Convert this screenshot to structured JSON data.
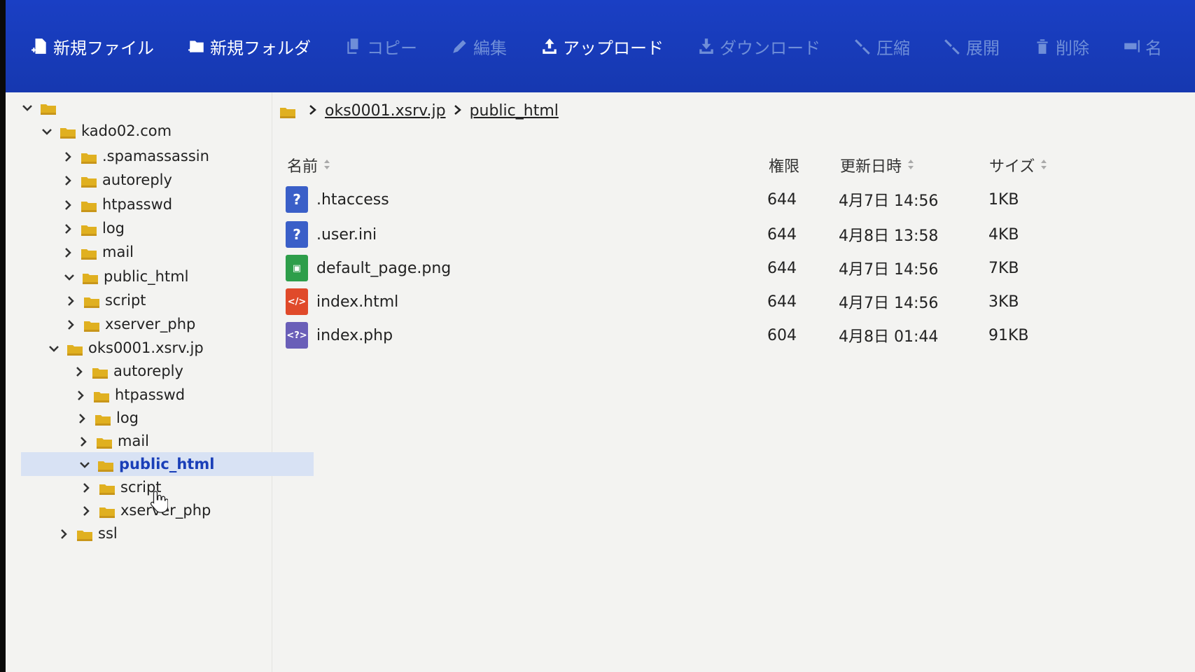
{
  "toolbar": {
    "buttons": [
      {
        "label": "新規ファイル",
        "icon": "new-file-icon",
        "enabled": true
      },
      {
        "label": "新規フォルダ",
        "icon": "new-folder-icon",
        "enabled": true
      },
      {
        "label": "コピー",
        "icon": "copy-icon",
        "enabled": false
      },
      {
        "label": "編集",
        "icon": "edit-icon",
        "enabled": false
      },
      {
        "label": "アップロード",
        "icon": "upload-icon",
        "enabled": true
      },
      {
        "label": "ダウンロード",
        "icon": "download-icon",
        "enabled": false
      },
      {
        "label": "圧縮",
        "icon": "compress-icon",
        "enabled": false
      },
      {
        "label": "展開",
        "icon": "extract-icon",
        "enabled": false
      },
      {
        "label": "削除",
        "icon": "trash-icon",
        "enabled": false
      },
      {
        "label": "名",
        "icon": "rename-icon",
        "enabled": false
      }
    ]
  },
  "tree": {
    "items": [
      {
        "label": "",
        "level": 0,
        "expanded": true
      },
      {
        "label": "kado02.com",
        "level": 1,
        "expanded": true
      },
      {
        "label": ".spamassassin",
        "level": 2,
        "expanded": false
      },
      {
        "label": "autoreply",
        "level": 2,
        "expanded": false
      },
      {
        "label": "htpasswd",
        "level": 2,
        "expanded": false
      },
      {
        "label": "log",
        "level": 2,
        "expanded": false
      },
      {
        "label": "mail",
        "level": 2,
        "expanded": false
      },
      {
        "label": "public_html",
        "level": 2,
        "expanded": true
      },
      {
        "label": "script",
        "level": 2,
        "expanded": false
      },
      {
        "label": "xserver_php",
        "level": 2,
        "expanded": false
      },
      {
        "label": "oks0001.xsrv.jp",
        "level": 1,
        "expanded": true
      },
      {
        "label": "autoreply",
        "level": 2,
        "expanded": false
      },
      {
        "label": "htpasswd",
        "level": 2,
        "expanded": false
      },
      {
        "label": "log",
        "level": 2,
        "expanded": false
      },
      {
        "label": "mail",
        "level": 2,
        "expanded": false
      },
      {
        "label": "public_html",
        "level": 2,
        "expanded": true,
        "selected": true
      },
      {
        "label": "script",
        "level": 2,
        "expanded": false
      },
      {
        "label": "xserver_php",
        "level": 2,
        "expanded": false
      },
      {
        "label": "ssl",
        "level": 1,
        "expanded": false
      }
    ]
  },
  "breadcrumb": {
    "items": [
      "oks0001.xsrv.jp",
      "public_html"
    ]
  },
  "table": {
    "headers": {
      "name": "名前",
      "perm": "権限",
      "date": "更新日時",
      "size": "サイズ"
    },
    "rows": [
      {
        "name": ".htaccess",
        "perm": "644",
        "date": "4月7日 14:56",
        "size": "1KB",
        "icon": "unknown-file-icon"
      },
      {
        "name": ".user.ini",
        "perm": "644",
        "date": "4月8日 13:58",
        "size": "4KB",
        "icon": "unknown-file-icon"
      },
      {
        "name": "default_page.png",
        "perm": "644",
        "date": "4月7日 14:56",
        "size": "7KB",
        "icon": "image-file-icon"
      },
      {
        "name": "index.html",
        "perm": "644",
        "date": "4月7日 14:56",
        "size": "3KB",
        "icon": "html-file-icon"
      },
      {
        "name": "index.php",
        "perm": "604",
        "date": "4月8日 01:44",
        "size": "91KB",
        "icon": "php-file-icon"
      }
    ]
  },
  "colors": {
    "toolbar": "#1a3fc4",
    "folder": "#e0b020",
    "selected_row": "#d8e2f4",
    "unknown_icon": "#3a5fc8",
    "image_icon": "#2e9e4a",
    "html_icon": "#e04a2a",
    "php_icon": "#6a5fb8"
  }
}
